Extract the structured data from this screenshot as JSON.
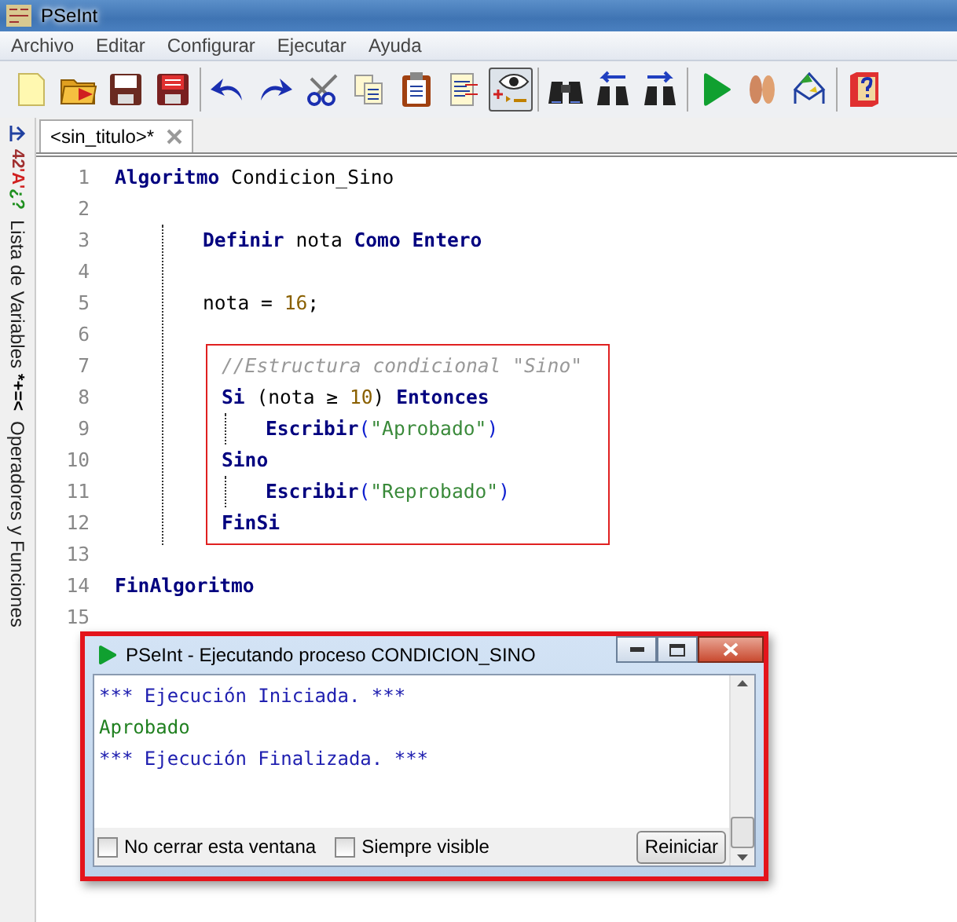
{
  "window": {
    "title": "PSeInt"
  },
  "menu": [
    "Archivo",
    "Editar",
    "Configurar",
    "Ejecutar",
    "Ayuda"
  ],
  "toolbar": [
    {
      "buttons": [
        {
          "pressed": false
        },
        {
          "pressed": false
        },
        {
          "pressed": false
        },
        {
          "pressed": false
        }
      ]
    },
    {
      "buttons": [
        {
          "pressed": false
        },
        {
          "pressed": false
        },
        {
          "pressed": false
        },
        {
          "pressed": false
        },
        {
          "pressed": false
        },
        {
          "pressed": false
        },
        {
          "pressed": true
        }
      ]
    },
    {
      "buttons": [
        {
          "pressed": false
        },
        {
          "pressed": false
        },
        {
          "pressed": false
        }
      ]
    },
    {
      "buttons": [
        {
          "pressed": false
        },
        {
          "pressed": false
        },
        {
          "pressed": false
        }
      ]
    },
    {
      "buttons": [
        {
          "pressed": false
        }
      ]
    }
  ],
  "side_panels": [
    {
      "icon_parts": [
        {
          "text": "42",
          "color": "#a03030"
        },
        {
          "text": "'A'",
          "color": "#d02020"
        },
        {
          "text": "¿?",
          "color": "#209020"
        }
      ],
      "label": "Lista de Variables"
    },
    {
      "icon_parts": [
        {
          "text": "*+=<",
          "color": "#000000"
        }
      ],
      "label": "Operadores y Funciones"
    }
  ],
  "editor_tabs": [
    {
      "label": "<sin_titulo>*",
      "selected": true
    }
  ],
  "code": [
    {
      "number": "1",
      "tokens": [
        {
          "kind": "kw",
          "text": "Algoritmo"
        },
        {
          "kind": "id",
          "text": " Condicion_Sino"
        }
      ]
    },
    {
      "number": "2"
    },
    {
      "kind": "block",
      "guide": true,
      "highlighted": false,
      "children": [
        {
          "number": "3",
          "tokens": [
            {
              "kind": "kw",
              "text": "Definir"
            },
            {
              "kind": "id",
              "text": " nota "
            },
            {
              "kind": "kw",
              "text": "Como Entero"
            }
          ]
        },
        {
          "number": "4"
        },
        {
          "number": "5",
          "tokens": [
            {
              "kind": "id",
              "text": "nota = "
            },
            {
              "kind": "num",
              "text": "16"
            },
            {
              "kind": "id",
              "text": ";"
            }
          ]
        },
        {
          "number": "6"
        },
        {
          "kind": "block",
          "guide": false,
          "highlighted": true,
          "children": [
            {
              "number": "7",
              "tokens": [
                {
                  "kind": "cmt",
                  "text": "//Estructura condicional \"Sino\""
                }
              ]
            },
            {
              "number": "8",
              "tokens": [
                {
                  "kind": "kw",
                  "text": "Si"
                },
                {
                  "kind": "id",
                  "text": " (nota ≥ "
                },
                {
                  "kind": "num",
                  "text": "10"
                },
                {
                  "kind": "id",
                  "text": ") "
                },
                {
                  "kind": "kw",
                  "text": "Entonces"
                }
              ]
            },
            {
              "kind": "block",
              "guide": true,
              "highlighted": false,
              "children": [
                {
                  "number": "9",
                  "tokens": [
                    {
                      "kind": "kw",
                      "text": "Escribir"
                    },
                    {
                      "kind": "paren",
                      "text": "("
                    },
                    {
                      "kind": "str",
                      "text": "\"Aprobado\""
                    },
                    {
                      "kind": "paren",
                      "text": ")"
                    }
                  ]
                }
              ]
            },
            {
              "number": "10",
              "tokens": [
                {
                  "kind": "kw",
                  "text": "Sino"
                }
              ]
            },
            {
              "kind": "block",
              "guide": true,
              "highlighted": false,
              "children": [
                {
                  "number": "11",
                  "tokens": [
                    {
                      "kind": "kw",
                      "text": "Escribir"
                    },
                    {
                      "kind": "paren",
                      "text": "("
                    },
                    {
                      "kind": "str",
                      "text": "\"Reprobado\""
                    },
                    {
                      "kind": "paren",
                      "text": ")"
                    }
                  ]
                }
              ]
            },
            {
              "number": "12",
              "tokens": [
                {
                  "kind": "kw",
                  "text": "FinSi"
                }
              ]
            }
          ]
        }
      ]
    },
    {
      "number": "13"
    },
    {
      "number": "14",
      "tokens": [
        {
          "kind": "kw",
          "text": "FinAlgoritmo"
        }
      ]
    },
    {
      "number": "15"
    }
  ],
  "run_dialog": {
    "title": "PSeInt - Ejecutando proceso CONDICION_SINO",
    "output": [
      {
        "kind": "system",
        "text": "*** Ejecución Iniciada. ***"
      },
      {
        "kind": "result",
        "text": "Aprobado"
      },
      {
        "kind": "system",
        "text": "*** Ejecución Finalizada. ***"
      }
    ],
    "options": [
      {
        "label": "No cerrar esta ventana",
        "checked": false
      },
      {
        "label": "Siempre visible",
        "checked": false
      }
    ],
    "button": "Reiniciar"
  }
}
